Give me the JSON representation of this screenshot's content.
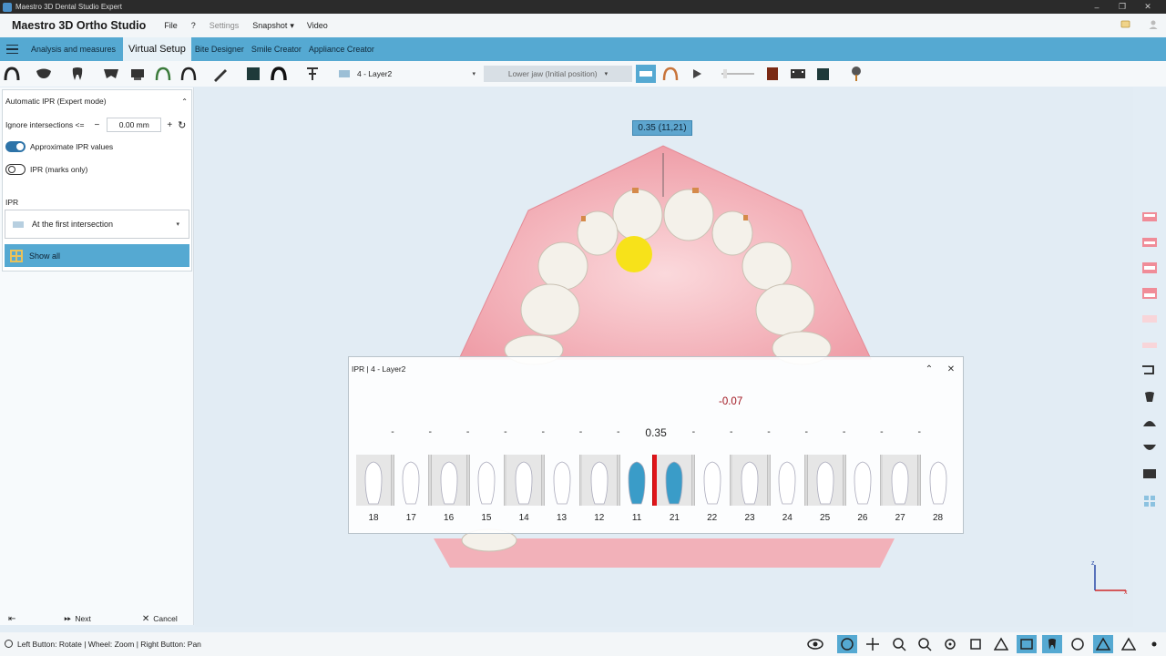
{
  "window": {
    "title": "Maestro 3D Dental Studio Expert",
    "controls": [
      "–",
      "❐",
      "✕"
    ]
  },
  "menubar": {
    "app_title": "Maestro 3D Ortho Studio",
    "items": [
      {
        "label": "File"
      },
      {
        "label": "?"
      },
      {
        "label": "Settings"
      },
      {
        "label": "Snapshot"
      },
      {
        "label": "Video"
      }
    ]
  },
  "tabs": [
    {
      "label": "Analysis and measures"
    },
    {
      "label": "Virtual Setup"
    },
    {
      "label": "Bite Designer"
    },
    {
      "label": "Smile Creator"
    },
    {
      "label": "Appliance Creator"
    }
  ],
  "toolbar": {
    "layer_select": "4 - Layer2",
    "jaw_select": "Lower jaw (Initial position)"
  },
  "left_panel": {
    "section_title": "Automatic IPR (Expert mode)",
    "ignore_label": "Ignore intersections <=",
    "ignore_value": "0.00 mm",
    "minus": "−",
    "plus": "+",
    "approx_label": "Approximate IPR values",
    "marks_label": "IPR (marks only)",
    "ipr_heading": "IPR",
    "mode_select": "At the first intersection",
    "show_all": "Show all",
    "next": "Next",
    "cancel": "Cancel",
    "approx_on": true,
    "marks_on": false
  },
  "viewport": {
    "ipr_tag": "0.35  (11,21)"
  },
  "ipr_dialog": {
    "title": "IPR | 4 - Layer2",
    "negative_value": "-0.07",
    "gaps": [
      "-",
      "-",
      "-",
      "-",
      "-",
      "-",
      "-",
      "0.35",
      "-",
      "-",
      "-",
      "-",
      "-",
      "-",
      "-"
    ],
    "teeth": [
      "18",
      "17",
      "16",
      "15",
      "14",
      "13",
      "12",
      "11",
      "21",
      "22",
      "23",
      "24",
      "25",
      "26",
      "27",
      "28"
    ]
  },
  "statusbar": {
    "hint": "Left Button: Rotate | Wheel: Zoom | Right Button: Pan"
  },
  "colors": {
    "accent": "#55a9d2",
    "selected_tooth": "#3a9cc8",
    "ipr_contact": "#e0151b",
    "gum": "#f4b8bf"
  }
}
